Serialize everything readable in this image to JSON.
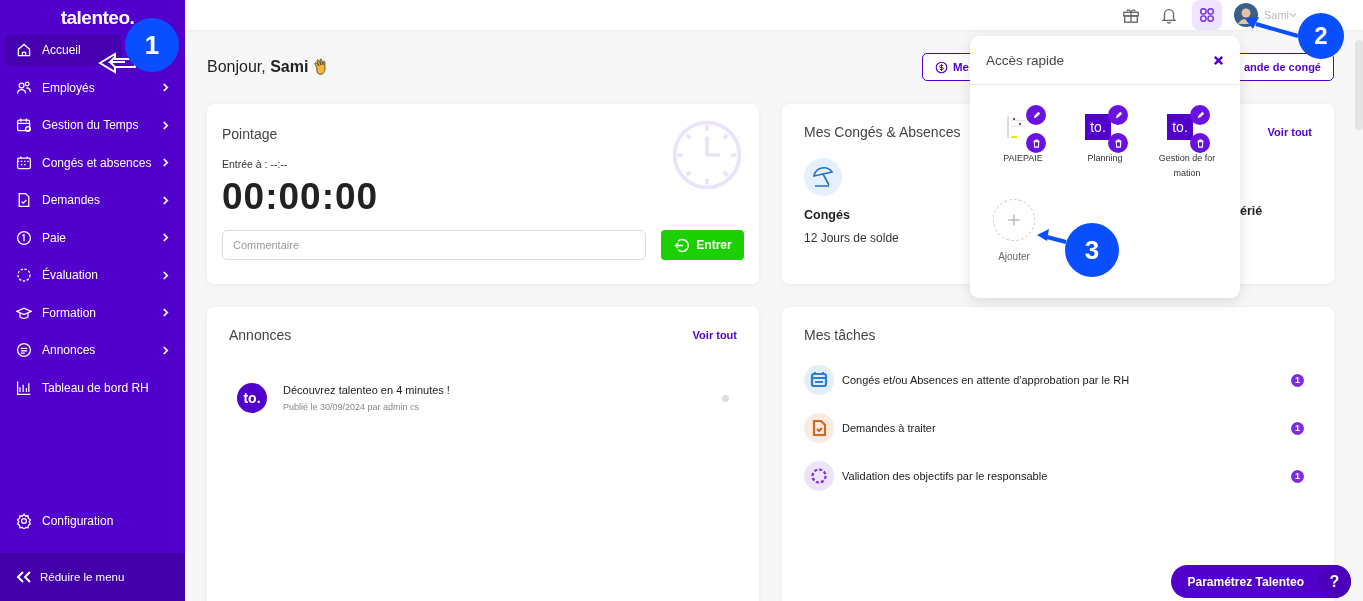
{
  "sidebar": {
    "logo": "talenteo.",
    "items": [
      {
        "label": "Accueil",
        "selected": true,
        "has_submenu": false
      },
      {
        "label": "Employés",
        "selected": false,
        "has_submenu": true
      },
      {
        "label": "Gestion du Temps",
        "selected": false,
        "has_submenu": true
      },
      {
        "label": "Congés et absences",
        "selected": false,
        "has_submenu": true
      },
      {
        "label": "Demandes",
        "selected": false,
        "has_submenu": true
      },
      {
        "label": "Paie",
        "selected": false,
        "has_submenu": true
      },
      {
        "label": "Évaluation",
        "selected": false,
        "has_submenu": true
      },
      {
        "label": "Formation",
        "selected": false,
        "has_submenu": true
      },
      {
        "label": "Annonces",
        "selected": false,
        "has_submenu": true
      },
      {
        "label": "Tableau de bord RH",
        "selected": false,
        "has_submenu": false
      }
    ],
    "configuration": "Configuration",
    "collapse": "Réduire le menu"
  },
  "topbar": {
    "user": "Sami",
    "apps_selected": true
  },
  "greeting": "Bonjour, **Sami**",
  "header_buttons": [
    "Me",
    "ande de congé"
  ],
  "pointage": {
    "title": "Pointage",
    "entry": "Entrée à : --:--",
    "timer": "00:00:00",
    "comment_placeholder": "Commentaire",
    "button": "Entrer"
  },
  "conges": {
    "title": "Mes Congés & Absences",
    "link": "Voir tout",
    "items": [
      {
        "label": "Congés",
        "detail": "12 Jours de solde"
      },
      {
        "label": "érié"
      }
    ]
  },
  "annonces": {
    "title": "Annonces",
    "link": "Voir tout",
    "items": [
      {
        "logo_text": "to.",
        "title": "Découvrez talenteo en 4 minutes !",
        "meta": "Publié le 30/09/2024 par admin cs"
      }
    ]
  },
  "taches": {
    "title": "Mes tâches",
    "items": [
      {
        "kind": "calendar",
        "color": "#2a7fd4",
        "label": "Congés et/ou Absences en attente d'approbation par le RH",
        "count": "1"
      },
      {
        "kind": "document",
        "color": "#d2691e",
        "label": "Demandes à traiter",
        "count": "1"
      },
      {
        "kind": "objective",
        "color": "#7a2ee0",
        "label": "Validation des objectifs par le responsable",
        "count": "1"
      }
    ]
  },
  "quick_access": {
    "title": "Accès rapide",
    "items": [
      {
        "kind": "picture",
        "label": "PAIEPAIE"
      },
      {
        "kind": "logo",
        "logo_text": "to.",
        "label": "Planning"
      },
      {
        "kind": "logo",
        "logo_text": "to.",
        "label": "Gestion de formation"
      }
    ],
    "add_label": "Ajouter"
  },
  "help_button": {
    "label": "Paramétrez Talenteo",
    "icon_text": "?"
  },
  "callouts": [
    {
      "number": "1"
    },
    {
      "number": "2"
    },
    {
      "number": "3"
    }
  ]
}
